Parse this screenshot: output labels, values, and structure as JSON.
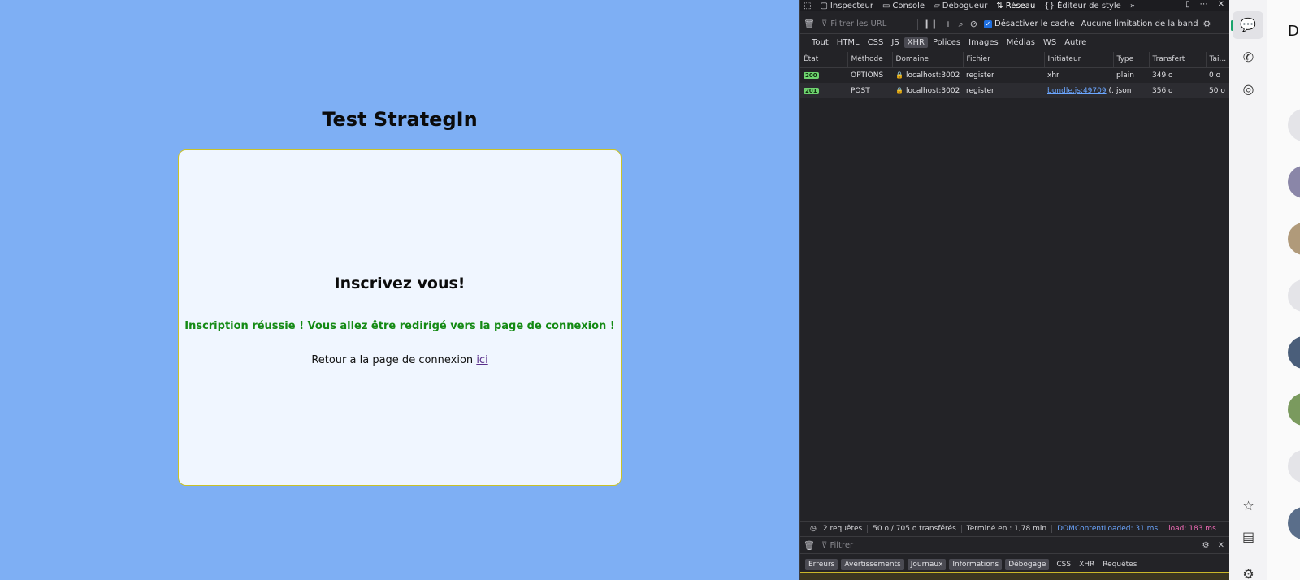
{
  "page": {
    "title": "Test StrategIn",
    "card": {
      "heading": "Inscrivez vous!",
      "success_message": "Inscription réussie ! Vous allez être redirigé vers la page de connexion !",
      "back_text": "Retour a la page de connexion",
      "back_link": "ici"
    }
  },
  "devtools": {
    "tabs": [
      "Inspecteur",
      "Console",
      "Débogueur",
      "Réseau",
      "Éditeur de style"
    ],
    "active_tab": "Réseau",
    "filter_placeholder": "Filtrer les URL",
    "disable_cache_label": "Désactiver le cache",
    "throttling": "Aucune limitation de la bande ...",
    "type_filters": [
      "Tout",
      "HTML",
      "CSS",
      "JS",
      "XHR",
      "Polices",
      "Images",
      "Médias",
      "WS",
      "Autre"
    ],
    "selected_type": "XHR",
    "columns": [
      "État",
      "Méthode",
      "Domaine",
      "Fichier",
      "Initiateur",
      "Type",
      "Transfert",
      "Tai..."
    ],
    "requests": [
      {
        "status": "200",
        "method": "OPTIONS",
        "domain": "localhost:3002",
        "file": "register",
        "initiator": "xhr",
        "type": "plain",
        "transfer": "349 o",
        "size": "0 o"
      },
      {
        "status": "201",
        "method": "POST",
        "domain": "localhost:3002",
        "file": "register",
        "initiator": "bundle.js:49709",
        "initiator_suffix": " (...",
        "type": "json",
        "transfer": "356 o",
        "size": "50 o"
      }
    ],
    "summary": {
      "requests": "2 requêtes",
      "transferred": "50 o / 705 o transférés",
      "finished": "Terminé en : 1,78 min",
      "dom_content_loaded": "DOMContentLoaded: 31 ms",
      "load": "load: 183 ms"
    },
    "console_filter_placeholder": "Filtrer",
    "console_levels": [
      "Erreurs",
      "Avertissements",
      "Journaux",
      "Informations",
      "Débogage"
    ],
    "console_extra": [
      "CSS",
      "XHR",
      "Requêtes"
    ]
  },
  "sidebar": {
    "icons": [
      "chat-icon",
      "phone-icon",
      "status-icon",
      "star-icon",
      "archive-icon",
      "settings-icon"
    ],
    "panel_initial": "D"
  }
}
